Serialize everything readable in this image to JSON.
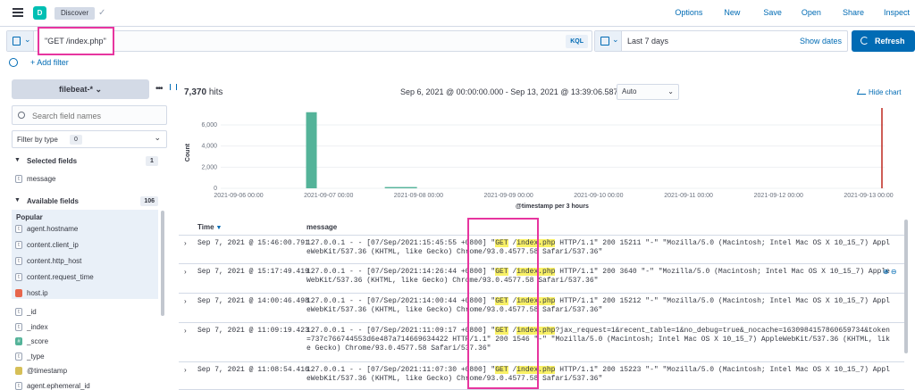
{
  "app": {
    "badge": "D",
    "breadcrumb": "Discover"
  },
  "top_links": [
    "Options",
    "New",
    "Save",
    "Open",
    "Share",
    "Inspect"
  ],
  "query": {
    "value": "\"GET /index.php\"",
    "language": "KQL"
  },
  "date_picker": {
    "range": "Last 7 days",
    "show_dates": "Show dates"
  },
  "refresh_label": "Refresh",
  "add_filter": "+ Add filter",
  "sidebar": {
    "index_pattern": "filebeat-*",
    "search_placeholder": "Search field names",
    "filter_by_type": "Filter by type",
    "filter_count": "0",
    "selected_title": "Selected fields",
    "selected_count": "1",
    "selected_fields": [
      {
        "type": "t",
        "name": "message"
      }
    ],
    "available_title": "Available fields",
    "available_count": "106",
    "popular_label": "Popular",
    "popular_fields": [
      {
        "type": "t",
        "name": "agent.hostname"
      },
      {
        "type": "t",
        "name": "content.client_ip"
      },
      {
        "type": "t",
        "name": "content.http_host"
      },
      {
        "type": "t",
        "name": "content.request_time"
      },
      {
        "type": "ip",
        "name": "host.ip"
      }
    ],
    "other_fields": [
      {
        "type": "t",
        "name": "_id"
      },
      {
        "type": "t",
        "name": "_index"
      },
      {
        "type": "#",
        "name": "_score"
      },
      {
        "type": "t",
        "name": "_type"
      },
      {
        "type": "date",
        "name": "@timestamp"
      },
      {
        "type": "t",
        "name": "agent.ephemeral_id"
      }
    ]
  },
  "results": {
    "hits_count": "7,370",
    "hits_label": "hits",
    "time_range": "Sep 6, 2021 @ 00:00:00.000 - Sep 13, 2021 @ 13:39:06.587",
    "interval": "Auto",
    "hide_chart": "Hide chart"
  },
  "chart_data": {
    "type": "bar",
    "title": "",
    "xlabel": "@timestamp per 3 hours",
    "ylabel": "Count",
    "y_ticks": [
      0,
      2000,
      4000,
      6000
    ],
    "y_tick_labels": [
      "0",
      "2,000",
      "4,000",
      "6,000"
    ],
    "ylim": [
      0,
      7600
    ],
    "x_tick_labels": [
      "2021-09-06 00:00",
      "2021-09-07 00:00",
      "2021-09-08 00:00",
      "2021-09-09 00:00",
      "2021-09-10 00:00",
      "2021-09-11 00:00",
      "2021-09-12 00:00",
      "2021-09-13 00:00"
    ],
    "bars": [
      {
        "x": "2021-09-06 18:00",
        "value": 7200
      },
      {
        "x": "2021-09-07 15:00",
        "value": 120
      }
    ],
    "bar_color": "#54b399",
    "now_marker_color": "#bd271e",
    "grid": true
  },
  "table": {
    "time_col": "Time",
    "msg_col": "message",
    "rows": [
      {
        "time": "Sep 7, 2021 @ 15:46:00.791",
        "pre": "127.0.0.1 - - [07/Sep/2021:15:45:55 +0800] \"",
        "hl1": "GET",
        "mid": " /",
        "hl2": "index.php",
        "post": " HTTP/1.1\" 200 15211 \"-\" \"Mozilla/5.0 (Macintosh; Intel Mac OS X 10_15_7) AppleWebKit/537.36 (KHTML, like Gecko) Chrome/93.0.4577.58 Safari/537.36\""
      },
      {
        "time": "Sep 7, 2021 @ 15:17:49.419",
        "pre": "127.0.0.1 - - [07/Sep/2021:14:26:44 +0800] \"",
        "hl1": "GET",
        "mid": " /",
        "hl2": "index.php",
        "post": " HTTP/1.1\" 200 3640 \"-\" \"Mozilla/5.0 (Macintosh; Intel Mac OS X 10_15_7) AppleWebKit/537.36 (KHTML, like Gecko) Chrome/93.0.4577.58 Safari/537.36\""
      },
      {
        "time": "Sep 7, 2021 @ 14:00:46.498",
        "pre": "127.0.0.1 - - [07/Sep/2021:14:00:44 +0800] \"",
        "hl1": "GET",
        "mid": " /",
        "hl2": "index.php",
        "post": " HTTP/1.1\" 200 15212 \"-\" \"Mozilla/5.0 (Macintosh; Intel Mac OS X 10_15_7) AppleWebKit/537.36 (KHTML, like Gecko) Chrome/93.0.4577.58 Safari/537.36\""
      },
      {
        "time": "Sep 7, 2021 @ 11:09:19.423",
        "pre": "127.0.0.1 - - [07/Sep/2021:11:09:17 +0800] \"",
        "hl1": "GET",
        "mid": " /",
        "hl2": "index.php",
        "post": "?jax_request=1&recent_table=1&no_debug=true&_nocache=1630984157860659734&token=737c766744553d6e487a714669634422 HTTP/1.1\" 200 1546 \"-\" \"Mozilla/5.0 (Macintosh; Intel Mac OS X 10_15_7) AppleWebKit/537.36 (KHTML, like Gecko) Chrome/93.0.4577.58 Safari/537.36\""
      },
      {
        "time": "Sep 7, 2021 @ 11:08:54.416",
        "pre": "127.0.0.1 - - [07/Sep/2021:11:07:30 +0800] \"",
        "hl1": "GET",
        "mid": " /",
        "hl2": "index.php",
        "post": " HTTP/1.1\" 200 15223 \"-\" \"Mozilla/5.0 (Macintosh; Intel Mac OS X 10_15_7) AppleWebKit/537.36 (KHTML, like Gecko) Chrome/93.0.4577.58 Safari/537.36\""
      }
    ]
  },
  "colors": {
    "accent": "#006bb4",
    "highlight": "#f9f166",
    "annotation": "#e7359f"
  }
}
